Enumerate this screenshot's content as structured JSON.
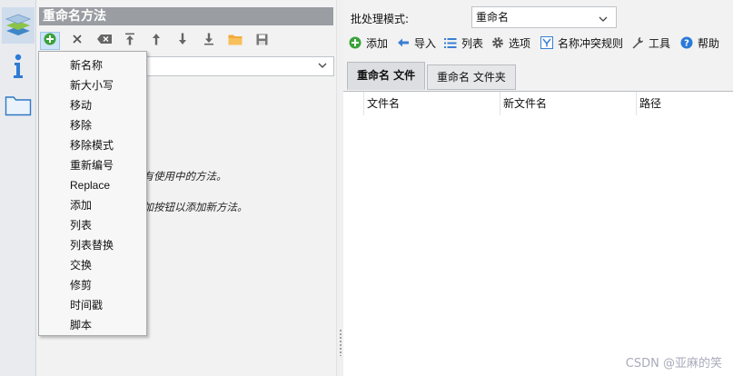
{
  "left_panel": {
    "title": "重命名方法",
    "method_dropdown_value": "",
    "hint_line1": "没有使用中的方法。",
    "hint_line2": "添加按钮以添加新方法。"
  },
  "left_toolbar": {
    "icons": [
      "add-icon",
      "delete-icon",
      "clear-icon",
      "move-top-icon",
      "move-up-icon",
      "move-down-icon",
      "move-bottom-icon",
      "folder-icon",
      "save-icon"
    ]
  },
  "add_menu": {
    "items": [
      "新名称",
      "新大小写",
      "移动",
      "移除",
      "移除模式",
      "重新编号",
      "Replace",
      "添加",
      "列表",
      "列表替换",
      "交换",
      "修剪",
      "时间戳",
      "脚本"
    ]
  },
  "right_panel": {
    "mode_label": "批处理模式:",
    "mode_value": "重命名",
    "toolbar": {
      "add": "添加",
      "import": "导入",
      "list": "列表",
      "options": "选项",
      "conflict_rules": "名称冲突规则",
      "tools": "工具",
      "help": "帮助"
    },
    "tabs": [
      "重命名 文件",
      "重命名 文件夹"
    ],
    "columns": [
      "文件名",
      "新文件名",
      "路径"
    ]
  },
  "watermark": "CSDN @亚麻的笑",
  "colors": {
    "title_bar": "#9a9da2",
    "rail_active": "#cfdcec",
    "add_green": "#3aa23a",
    "help_blue": "#2a7ad8"
  }
}
